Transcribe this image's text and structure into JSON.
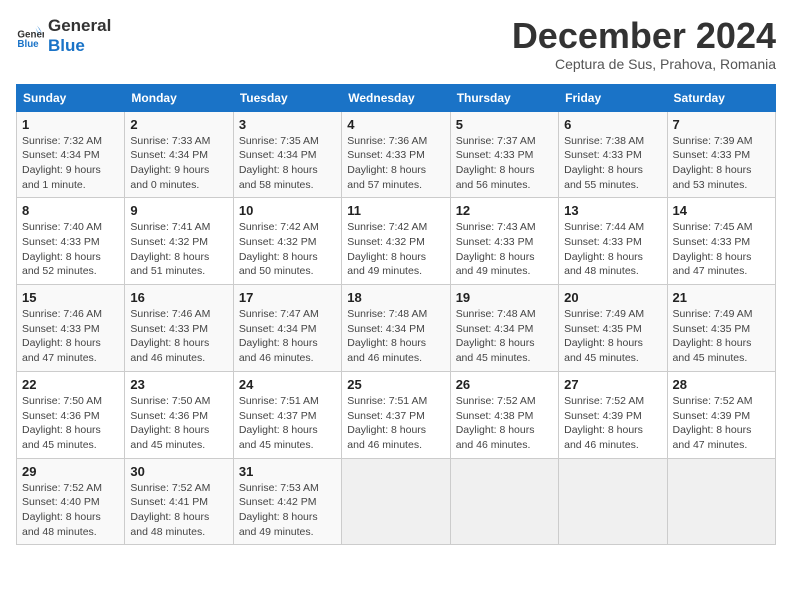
{
  "header": {
    "logo_line1": "General",
    "logo_line2": "Blue",
    "month_title": "December 2024",
    "location": "Ceptura de Sus, Prahova, Romania"
  },
  "weekdays": [
    "Sunday",
    "Monday",
    "Tuesday",
    "Wednesday",
    "Thursday",
    "Friday",
    "Saturday"
  ],
  "weeks": [
    [
      {
        "day": "1",
        "sunrise": "7:32 AM",
        "sunset": "4:34 PM",
        "daylight": "9 hours and 1 minute."
      },
      {
        "day": "2",
        "sunrise": "7:33 AM",
        "sunset": "4:34 PM",
        "daylight": "9 hours and 0 minutes."
      },
      {
        "day": "3",
        "sunrise": "7:35 AM",
        "sunset": "4:34 PM",
        "daylight": "8 hours and 58 minutes."
      },
      {
        "day": "4",
        "sunrise": "7:36 AM",
        "sunset": "4:33 PM",
        "daylight": "8 hours and 57 minutes."
      },
      {
        "day": "5",
        "sunrise": "7:37 AM",
        "sunset": "4:33 PM",
        "daylight": "8 hours and 56 minutes."
      },
      {
        "day": "6",
        "sunrise": "7:38 AM",
        "sunset": "4:33 PM",
        "daylight": "8 hours and 55 minutes."
      },
      {
        "day": "7",
        "sunrise": "7:39 AM",
        "sunset": "4:33 PM",
        "daylight": "8 hours and 53 minutes."
      }
    ],
    [
      {
        "day": "8",
        "sunrise": "7:40 AM",
        "sunset": "4:33 PM",
        "daylight": "8 hours and 52 minutes."
      },
      {
        "day": "9",
        "sunrise": "7:41 AM",
        "sunset": "4:32 PM",
        "daylight": "8 hours and 51 minutes."
      },
      {
        "day": "10",
        "sunrise": "7:42 AM",
        "sunset": "4:32 PM",
        "daylight": "8 hours and 50 minutes."
      },
      {
        "day": "11",
        "sunrise": "7:42 AM",
        "sunset": "4:32 PM",
        "daylight": "8 hours and 49 minutes."
      },
      {
        "day": "12",
        "sunrise": "7:43 AM",
        "sunset": "4:33 PM",
        "daylight": "8 hours and 49 minutes."
      },
      {
        "day": "13",
        "sunrise": "7:44 AM",
        "sunset": "4:33 PM",
        "daylight": "8 hours and 48 minutes."
      },
      {
        "day": "14",
        "sunrise": "7:45 AM",
        "sunset": "4:33 PM",
        "daylight": "8 hours and 47 minutes."
      }
    ],
    [
      {
        "day": "15",
        "sunrise": "7:46 AM",
        "sunset": "4:33 PM",
        "daylight": "8 hours and 47 minutes."
      },
      {
        "day": "16",
        "sunrise": "7:46 AM",
        "sunset": "4:33 PM",
        "daylight": "8 hours and 46 minutes."
      },
      {
        "day": "17",
        "sunrise": "7:47 AM",
        "sunset": "4:34 PM",
        "daylight": "8 hours and 46 minutes."
      },
      {
        "day": "18",
        "sunrise": "7:48 AM",
        "sunset": "4:34 PM",
        "daylight": "8 hours and 46 minutes."
      },
      {
        "day": "19",
        "sunrise": "7:48 AM",
        "sunset": "4:34 PM",
        "daylight": "8 hours and 45 minutes."
      },
      {
        "day": "20",
        "sunrise": "7:49 AM",
        "sunset": "4:35 PM",
        "daylight": "8 hours and 45 minutes."
      },
      {
        "day": "21",
        "sunrise": "7:49 AM",
        "sunset": "4:35 PM",
        "daylight": "8 hours and 45 minutes."
      }
    ],
    [
      {
        "day": "22",
        "sunrise": "7:50 AM",
        "sunset": "4:36 PM",
        "daylight": "8 hours and 45 minutes."
      },
      {
        "day": "23",
        "sunrise": "7:50 AM",
        "sunset": "4:36 PM",
        "daylight": "8 hours and 45 minutes."
      },
      {
        "day": "24",
        "sunrise": "7:51 AM",
        "sunset": "4:37 PM",
        "daylight": "8 hours and 45 minutes."
      },
      {
        "day": "25",
        "sunrise": "7:51 AM",
        "sunset": "4:37 PM",
        "daylight": "8 hours and 46 minutes."
      },
      {
        "day": "26",
        "sunrise": "7:52 AM",
        "sunset": "4:38 PM",
        "daylight": "8 hours and 46 minutes."
      },
      {
        "day": "27",
        "sunrise": "7:52 AM",
        "sunset": "4:39 PM",
        "daylight": "8 hours and 46 minutes."
      },
      {
        "day": "28",
        "sunrise": "7:52 AM",
        "sunset": "4:39 PM",
        "daylight": "8 hours and 47 minutes."
      }
    ],
    [
      {
        "day": "29",
        "sunrise": "7:52 AM",
        "sunset": "4:40 PM",
        "daylight": "8 hours and 48 minutes."
      },
      {
        "day": "30",
        "sunrise": "7:52 AM",
        "sunset": "4:41 PM",
        "daylight": "8 hours and 48 minutes."
      },
      {
        "day": "31",
        "sunrise": "7:53 AM",
        "sunset": "4:42 PM",
        "daylight": "8 hours and 49 minutes."
      },
      null,
      null,
      null,
      null
    ]
  ],
  "labels": {
    "sunrise": "Sunrise:",
    "sunset": "Sunset:",
    "daylight": "Daylight:"
  }
}
